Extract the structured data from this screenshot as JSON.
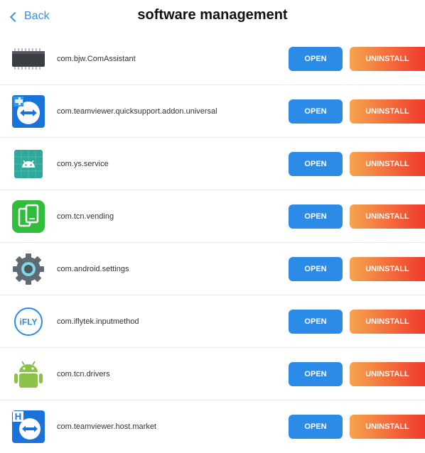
{
  "header": {
    "back_label": "Back",
    "title": "software management"
  },
  "buttons": {
    "open_label": "OPEN",
    "uninstall_label": "UNINSTALL"
  },
  "colors": {
    "accent_blue": "#2b8be6",
    "back_blue": "#3d8fe0",
    "uninstall_gradient_start": "#f4a54e",
    "uninstall_gradient_end": "#ef3a2e"
  },
  "apps": [
    {
      "package": "com.bjw.ComAssistant",
      "icon": "chip-icon"
    },
    {
      "package": "com.teamviewer.quicksupport.addon.universal",
      "icon": "teamviewer-addon-icon"
    },
    {
      "package": "com.ys.service",
      "icon": "android-service-icon"
    },
    {
      "package": "com.tcn.vending",
      "icon": "vending-icon"
    },
    {
      "package": "com.android.settings",
      "icon": "settings-gear-icon"
    },
    {
      "package": "com.iflytek.inputmethod",
      "icon": "ifly-icon",
      "icon_text": "iFLY"
    },
    {
      "package": "com.tcn.drivers",
      "icon": "android-robot-icon"
    },
    {
      "package": "com.teamviewer.host.market",
      "icon": "teamviewer-host-icon",
      "icon_badge": "H"
    }
  ]
}
